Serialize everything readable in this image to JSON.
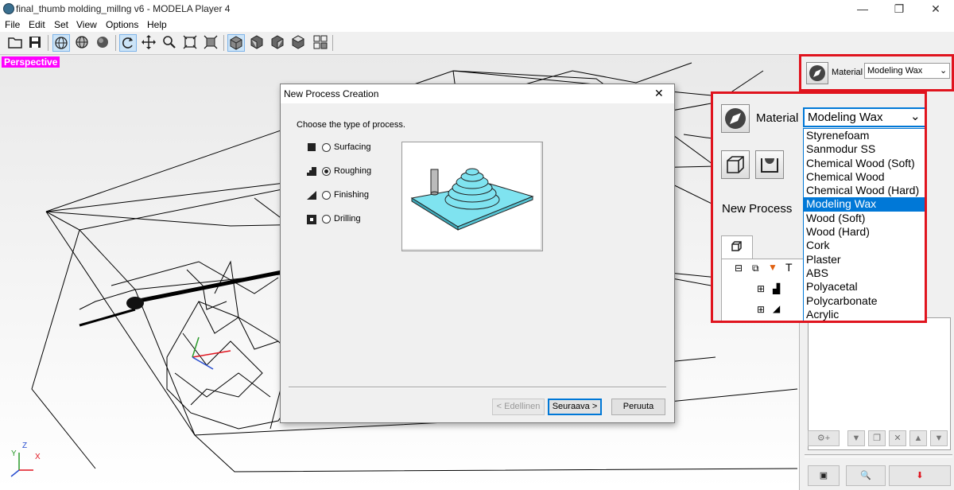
{
  "window": {
    "title": "final_thumb molding_millng v6 - MODELA Player 4",
    "minimize_glyph": "—",
    "restore_glyph": "❐",
    "close_glyph": "✕"
  },
  "menu": [
    "File",
    "Edit",
    "Set",
    "View",
    "Options",
    "Help"
  ],
  "toolbar": {
    "icons": [
      "open-folder-icon",
      "save-icon",
      "wireframe-globe-icon",
      "shaded-globe-icon",
      "solid-sphere-icon",
      "rotate-icon",
      "move-icon",
      "zoom-icon",
      "fit-icon",
      "fit-selection-icon",
      "iso-view-icon",
      "front-view-icon",
      "side-view-icon",
      "top-view-icon",
      "grid-view-icon"
    ]
  },
  "viewport": {
    "view_label": "Perspective",
    "axis_x": "X",
    "axis_y": "Y",
    "axis_z": "Z"
  },
  "dialog": {
    "title": "New Process Creation",
    "close_glyph": "✕",
    "prompt": "Choose the type of process.",
    "options": [
      "Surfacing",
      "Roughing",
      "Finishing",
      "Drilling"
    ],
    "selected": "Roughing",
    "buttons": {
      "back": "< Edellinen",
      "next": "Seuraava >",
      "cancel": "Peruuta"
    }
  },
  "panel_small": {
    "material_label": "Material",
    "material_value": "Modeling Wax"
  },
  "panel_zoom": {
    "material_label": "Material",
    "material_value": "Modeling Wax",
    "new_process_label": "New Process",
    "tree_root_label": "T",
    "materials": [
      "Styrenefoam",
      "Sanmodur SS",
      "Chemical Wood (Soft)",
      "Chemical Wood",
      "Chemical Wood (Hard)",
      "Modeling Wax",
      "Wood (Soft)",
      "Wood (Hard)",
      "Cork",
      "Plaster",
      "ABS",
      "Polyacetal",
      "Polycarbonate",
      "Acrylic"
    ],
    "selected_material": "Modeling Wax"
  },
  "colors": {
    "highlight_red": "#e0141e",
    "selection_blue": "#0078d7",
    "perspective_magenta": "#ff00ff",
    "stock_cyan": "#7fe3f0"
  }
}
